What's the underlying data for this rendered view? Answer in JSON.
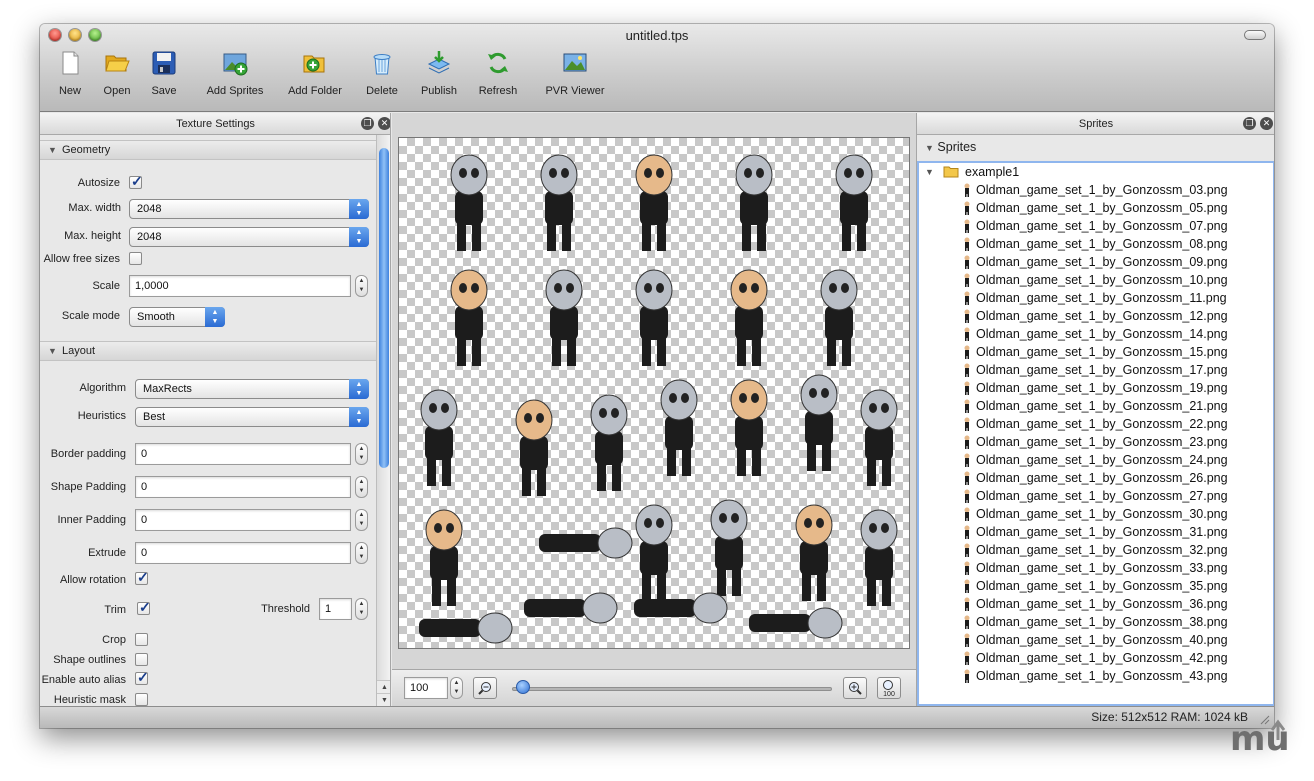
{
  "window": {
    "title": "untitled.tps"
  },
  "toolbar": {
    "items": [
      {
        "label": "New",
        "icon": "new-document-icon"
      },
      {
        "label": "Open",
        "icon": "folder-open-icon"
      },
      {
        "label": "Save",
        "icon": "floppy-disk-icon"
      },
      {
        "label": "Add Sprites",
        "icon": "add-image-icon"
      },
      {
        "label": "Add Folder",
        "icon": "add-folder-icon"
      },
      {
        "label": "Delete",
        "icon": "trash-icon"
      },
      {
        "label": "Publish",
        "icon": "publish-download-icon"
      },
      {
        "label": "Refresh",
        "icon": "refresh-arrows-icon"
      },
      {
        "label": "PVR Viewer",
        "icon": "image-viewer-icon"
      }
    ]
  },
  "texture_settings": {
    "title": "Texture Settings",
    "geometry": {
      "title": "Geometry",
      "autosize_label": "Autosize",
      "autosize": true,
      "max_width_label": "Max. width",
      "max_width": "2048",
      "max_height_label": "Max. height",
      "max_height": "2048",
      "allow_free_sizes_label": "Allow free sizes",
      "allow_free_sizes": false,
      "scale_label": "Scale",
      "scale": "1,0000",
      "scale_mode_label": "Scale mode",
      "scale_mode": "Smooth"
    },
    "layout": {
      "title": "Layout",
      "algorithm_label": "Algorithm",
      "algorithm": "MaxRects",
      "heuristics_label": "Heuristics",
      "heuristics": "Best",
      "border_padding_label": "Border padding",
      "border_padding": "0",
      "shape_padding_label": "Shape Padding",
      "shape_padding": "0",
      "inner_padding_label": "Inner Padding",
      "inner_padding": "0",
      "extrude_label": "Extrude",
      "extrude": "0",
      "allow_rotation_label": "Allow rotation",
      "allow_rotation": true,
      "trim_label": "Trim",
      "trim": true,
      "threshold_label": "Threshold",
      "threshold": "1",
      "crop_label": "Crop",
      "crop": false,
      "shape_outlines_label": "Shape outlines",
      "shape_outlines": false,
      "enable_auto_alias_label": "Enable auto alias",
      "enable_auto_alias": true,
      "heuristic_mask_label": "Heuristic mask",
      "heuristic_mask": false
    }
  },
  "preview": {
    "zoom": "100",
    "zoom_100_label": "100",
    "zoom_level": 0.02
  },
  "sprites_panel": {
    "title": "Sprites",
    "root_label": "Sprites",
    "folder": "example1",
    "files": [
      "Oldman_game_set_1_by_Gonzossm_03.png",
      "Oldman_game_set_1_by_Gonzossm_05.png",
      "Oldman_game_set_1_by_Gonzossm_07.png",
      "Oldman_game_set_1_by_Gonzossm_08.png",
      "Oldman_game_set_1_by_Gonzossm_09.png",
      "Oldman_game_set_1_by_Gonzossm_10.png",
      "Oldman_game_set_1_by_Gonzossm_11.png",
      "Oldman_game_set_1_by_Gonzossm_12.png",
      "Oldman_game_set_1_by_Gonzossm_14.png",
      "Oldman_game_set_1_by_Gonzossm_15.png",
      "Oldman_game_set_1_by_Gonzossm_17.png",
      "Oldman_game_set_1_by_Gonzossm_19.png",
      "Oldman_game_set_1_by_Gonzossm_21.png",
      "Oldman_game_set_1_by_Gonzossm_22.png",
      "Oldman_game_set_1_by_Gonzossm_23.png",
      "Oldman_game_set_1_by_Gonzossm_24.png",
      "Oldman_game_set_1_by_Gonzossm_26.png",
      "Oldman_game_set_1_by_Gonzossm_27.png",
      "Oldman_game_set_1_by_Gonzossm_30.png",
      "Oldman_game_set_1_by_Gonzossm_31.png",
      "Oldman_game_set_1_by_Gonzossm_32.png",
      "Oldman_game_set_1_by_Gonzossm_33.png",
      "Oldman_game_set_1_by_Gonzossm_35.png",
      "Oldman_game_set_1_by_Gonzossm_36.png",
      "Oldman_game_set_1_by_Gonzossm_38.png",
      "Oldman_game_set_1_by_Gonzossm_40.png",
      "Oldman_game_set_1_by_Gonzossm_42.png",
      "Oldman_game_set_1_by_Gonzossm_43.png"
    ]
  },
  "status": {
    "text": "Size: 512x512 RAM: 1024 kB"
  },
  "watermark": {
    "text": "mu"
  },
  "colors": {
    "accent": "#2a6ad3",
    "selection_border": "#8fb6ee",
    "sprite_suit": "#1c1c1c",
    "sprite_mask": "#b9bec6",
    "sprite_skin": "#e6b98a"
  }
}
